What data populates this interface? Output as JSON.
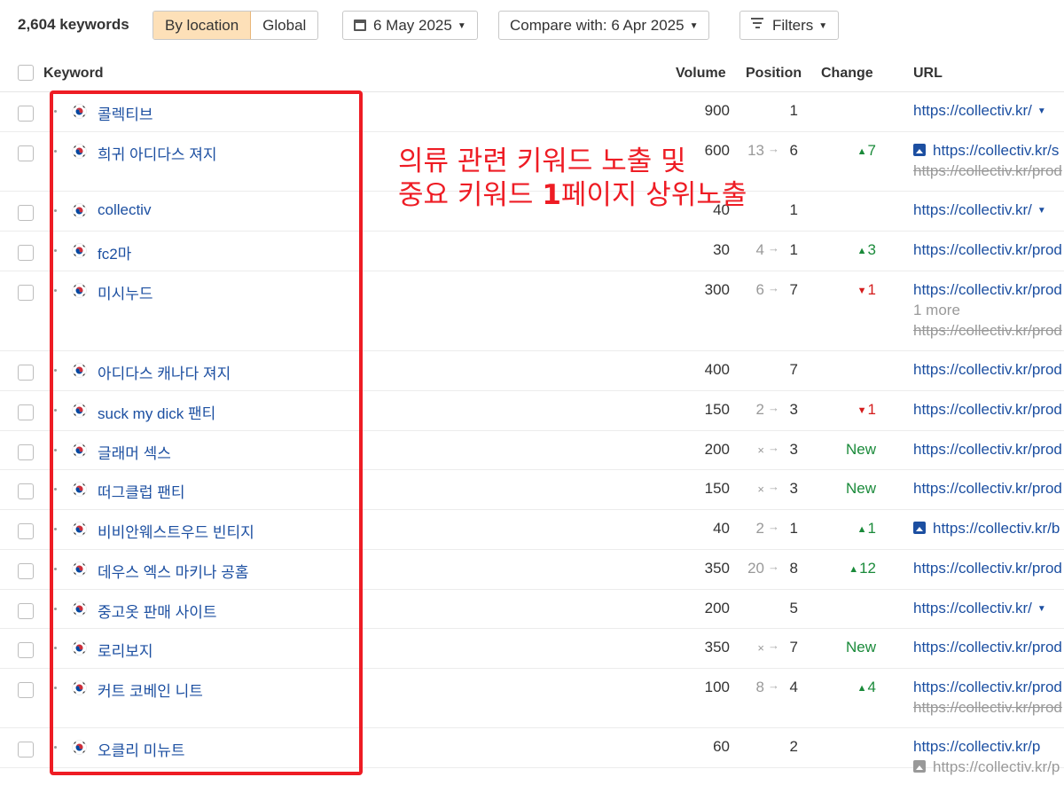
{
  "toolbar": {
    "keyword_count": "2,604 keywords",
    "by_location": "By location",
    "global": "Global",
    "date": "6 May 2025",
    "compare": "Compare with: 6 Apr 2025",
    "filters": "Filters"
  },
  "table": {
    "headers": {
      "keyword": "Keyword",
      "volume": "Volume",
      "position": "Position",
      "change": "Change",
      "url": "URL"
    },
    "rows": [
      {
        "keyword": "콜렉티브",
        "volume": "900",
        "pos_old": "",
        "pos_new": "1",
        "change": "",
        "change_type": "",
        "url": "https://collectiv.kr/",
        "url_dropdown": true
      },
      {
        "keyword": "희귀 아디다스 져지",
        "volume": "600",
        "pos_old": "13",
        "pos_new": "6",
        "change": "7",
        "change_type": "up",
        "url": "https://collectiv.kr/s",
        "url_image": true,
        "url2": "https://collectiv.kr/prod"
      },
      {
        "keyword": "collectiv",
        "volume": "40",
        "pos_old": "",
        "pos_new": "1",
        "change": "",
        "change_type": "",
        "url": "https://collectiv.kr/",
        "url_dropdown": true
      },
      {
        "keyword": "fc2마",
        "volume": "30",
        "pos_old": "4",
        "pos_new": "1",
        "change": "3",
        "change_type": "up",
        "url": "https://collectiv.kr/prod"
      },
      {
        "keyword": "미시누드",
        "volume": "300",
        "pos_old": "6",
        "pos_new": "7",
        "change": "1",
        "change_type": "down",
        "url": "https://collectiv.kr/prod",
        "more": "1 more",
        "url3": "https://collectiv.kr/prod"
      },
      {
        "keyword": "아디다스 캐나다 져지",
        "volume": "400",
        "pos_old": "",
        "pos_new": "7",
        "change": "",
        "change_type": "",
        "url": "https://collectiv.kr/prod"
      },
      {
        "keyword": "suck my dick 팬티",
        "volume": "150",
        "pos_old": "2",
        "pos_new": "3",
        "change": "1",
        "change_type": "down",
        "url": "https://collectiv.kr/prod"
      },
      {
        "keyword": "글래머 섹스",
        "volume": "200",
        "pos_old": "×",
        "pos_new": "3",
        "change": "New",
        "change_type": "new",
        "url": "https://collectiv.kr/prod"
      },
      {
        "keyword": "떠그클럽 팬티",
        "volume": "150",
        "pos_old": "×",
        "pos_new": "3",
        "change": "New",
        "change_type": "new",
        "url": "https://collectiv.kr/prod"
      },
      {
        "keyword": "비비안웨스트우드 빈티지",
        "volume": "40",
        "pos_old": "2",
        "pos_new": "1",
        "change": "1",
        "change_type": "up",
        "url": "https://collectiv.kr/b",
        "url_image": true
      },
      {
        "keyword": "데우스 엑스 마키나 공홈",
        "volume": "350",
        "pos_old": "20",
        "pos_new": "8",
        "change": "12",
        "change_type": "up",
        "url": "https://collectiv.kr/prod"
      },
      {
        "keyword": "중고옷 판매 사이트",
        "volume": "200",
        "pos_old": "",
        "pos_new": "5",
        "change": "",
        "change_type": "",
        "url": "https://collectiv.kr/",
        "url_dropdown": true
      },
      {
        "keyword": "로리보지",
        "volume": "350",
        "pos_old": "×",
        "pos_new": "7",
        "change": "New",
        "change_type": "new",
        "url": "https://collectiv.kr/prod"
      },
      {
        "keyword": "커트 코베인 니트",
        "volume": "100",
        "pos_old": "8",
        "pos_new": "4",
        "change": "4",
        "change_type": "up",
        "url": "https://collectiv.kr/prod",
        "url2": "https://collectiv.kr/prod"
      },
      {
        "keyword": "오클리 미뉴트",
        "volume": "60",
        "pos_old": "",
        "pos_new": "2",
        "change": "",
        "change_type": "",
        "url": "https://collectiv.kr/p",
        "url_grey_image": "https://collectiv.kr/p"
      }
    ]
  },
  "annotation": {
    "line1": "의류 관련 키워드 노출 및",
    "line2_pre": "중요 키워드 ",
    "line2_bold": "1",
    "line2_post": "페이지 상위노출",
    "color": "#ee1c24"
  },
  "colors": {
    "link": "#1c4fa1",
    "up": "#1a8a3a",
    "down": "#d41c1c",
    "active_segment": "#fde0b8"
  }
}
